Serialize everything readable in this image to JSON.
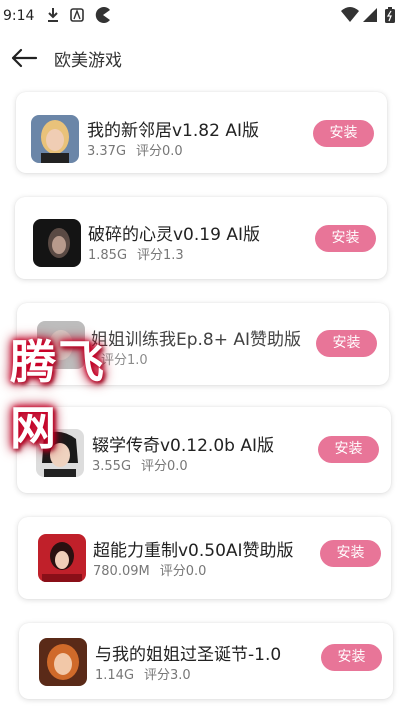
{
  "status_bar": {
    "time": "9:14"
  },
  "header": {
    "title": "欧美游戏",
    "back_icon": "arrow-left-icon"
  },
  "accent_color": "#e87598",
  "games": [
    {
      "name": "我的新邻居v1.82 AI版",
      "size": "3.37G",
      "rating": "评分0.0",
      "button": "安装"
    },
    {
      "name": "破碎的心灵v0.19 AI版",
      "size": "1.85G",
      "rating": "评分1.3",
      "button": "安装"
    },
    {
      "name": "姐姐训练我Ep.8+ AI赞助版",
      "size": "",
      "rating": "评分1.0",
      "button": "安装"
    },
    {
      "name": "辍学传奇v0.12.0b AI版",
      "size": "3.55G",
      "rating": "评分0.0",
      "button": "安装"
    },
    {
      "name": "超能力重制v0.50AI赞助版",
      "size": "780.09M",
      "rating": "评分0.0",
      "button": "安装"
    },
    {
      "name": "与我的姐姐过圣诞节-1.0",
      "size": "1.14G",
      "rating": "评分3.0",
      "button": "安装"
    }
  ],
  "watermark": "腾飞网"
}
